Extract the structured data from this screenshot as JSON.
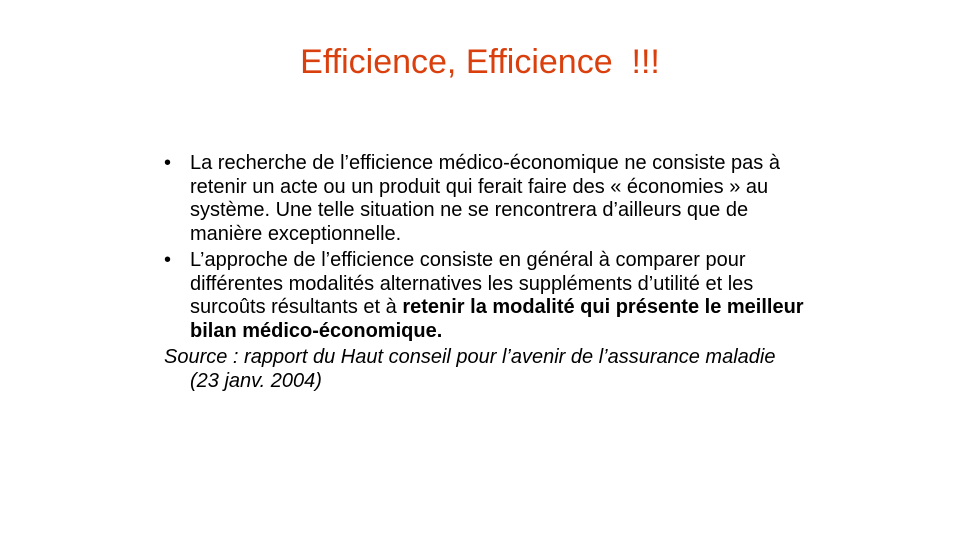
{
  "slide": {
    "title": "Efficience, Efficience  !!!",
    "bullets": [
      {
        "glyph": "•",
        "text": "La recherche de l’efficience médico-économique ne consiste pas à retenir un acte ou un produit qui ferait faire des « économies » au système. Une telle situation ne se rencontrera d’ailleurs que de manière exceptionnelle."
      },
      {
        "glyph": "•",
        "text": "L’approche de l’efficience consiste en général à comparer pour différentes modalités alternatives les suppléments d’utilité et les surcoûts résultants et à ",
        "bold_text": "retenir la modalité qui présente le meilleur bilan médico-économique."
      }
    ],
    "source": "Source : rapport du Haut conseil pour l’avenir de l’assurance maladie (23 janv. 2004)"
  },
  "colors": {
    "title": "#d9400e",
    "body_text": "#000000",
    "background": "#ffffff"
  }
}
